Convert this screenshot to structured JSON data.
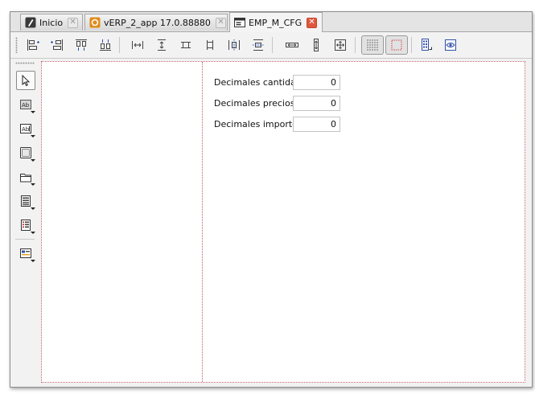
{
  "tabs": [
    {
      "label": "Inicio",
      "icon": "home-icon",
      "active": false
    },
    {
      "label": "vERP_2_app 17.0.88880",
      "icon": "app-icon",
      "active": false
    },
    {
      "label": "EMP_M_CFG",
      "icon": "form-icon",
      "active": true
    }
  ],
  "tab_close_symbol": "✕",
  "toolbar": {
    "buttons": [
      {
        "icon": "align-left-icon"
      },
      {
        "icon": "align-right-icon"
      },
      {
        "icon": "align-top-icon"
      },
      {
        "icon": "align-bottom-icon"
      },
      {
        "icon": "space-horizontal-icon"
      },
      {
        "icon": "space-vertical-icon"
      },
      {
        "icon": "same-width-icon"
      },
      {
        "icon": "same-height-icon"
      },
      {
        "icon": "center-horizontal-icon"
      },
      {
        "icon": "center-vertical-icon"
      },
      {
        "icon": "stretch-horizontal-icon"
      },
      {
        "icon": "stretch-vertical-icon"
      },
      {
        "icon": "stretch-both-icon"
      },
      {
        "icon": "show-grid-icon",
        "toggled": true
      },
      {
        "icon": "show-borders-icon",
        "toggled": true
      },
      {
        "icon": "properties-icon"
      },
      {
        "icon": "preview-icon"
      }
    ]
  },
  "palette": {
    "tools": [
      {
        "icon": "pointer-icon",
        "selected": true
      },
      {
        "icon": "label-tool-icon"
      },
      {
        "icon": "textfield-tool-icon"
      },
      {
        "icon": "panel-tool-icon"
      },
      {
        "icon": "folder-tool-icon"
      },
      {
        "icon": "list-tool-icon"
      },
      {
        "icon": "table-tool-icon"
      },
      {
        "icon": "image-tool-icon"
      }
    ]
  },
  "form": {
    "fields": [
      {
        "label": "Decimales cantidad",
        "value": "0"
      },
      {
        "label": "Decimales precios",
        "value": "0"
      },
      {
        "label": "Decimales importes",
        "value": "0"
      }
    ]
  },
  "colors": {
    "design_border": "#c0606a",
    "active_close": "#e0573c",
    "icon_blue": "#2f4fa8"
  }
}
